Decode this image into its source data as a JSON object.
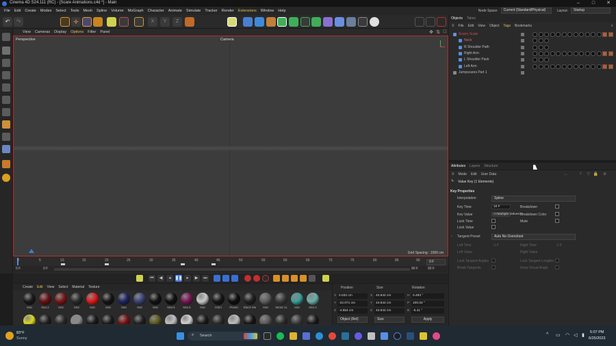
{
  "window": {
    "title": "Cinema 4D S24.111 (RC) - [Scare Animations.c4d *] - Main"
  },
  "menubar": {
    "items": [
      "File",
      "Edit",
      "Create",
      "Modes",
      "Select",
      "Tools",
      "Mesh",
      "Spline",
      "Volume",
      "MoGraph",
      "Character",
      "Animate",
      "Simulate",
      "Tracker",
      "Render",
      "Extensions",
      "Window",
      "Help"
    ],
    "node_space_label": "Node Space:",
    "node_space_value": "Current (Standard/Physical)",
    "layout_label": "Layout:",
    "layout_value": "Startup"
  },
  "viewport": {
    "menu": [
      "View",
      "Cameras",
      "Display",
      "Options",
      "Filter",
      "Panel"
    ],
    "label": "Perspective",
    "camera": "Camera",
    "grid_spacing": "Grid Spacing : 1000 cm"
  },
  "timeline": {
    "ticks": [
      "0",
      "5",
      "10",
      "15",
      "20",
      "25",
      "30",
      "35",
      "40",
      "45",
      "50",
      "55",
      "60",
      "65",
      "70",
      "75",
      "80",
      "85",
      "90"
    ],
    "current_frame": "0 F",
    "start_field": "0 F",
    "start_field2": "0 F",
    "end_field": "90 F",
    "end_field2": "90 F",
    "right_frame": "0 F"
  },
  "material_manager": {
    "menu": [
      "Create",
      "Edit",
      "View",
      "Select",
      "Material",
      "Texture"
    ],
    "materials": [
      {
        "name": "Mat",
        "color": "#1a1a1a"
      },
      {
        "name": "Mat.2",
        "color": "#6a1010"
      },
      {
        "name": "Mat",
        "color": "#7a1515"
      },
      {
        "name": "Mat",
        "color": "#2a2a2a"
      },
      {
        "name": "Mat",
        "color": "#e01818"
      },
      {
        "name": "Mat",
        "color": "#151515"
      },
      {
        "name": "Mat",
        "color": "#1c2460"
      },
      {
        "name": "Mat",
        "color": "#3a4275"
      },
      {
        "name": "Mat",
        "color": "#121212"
      },
      {
        "name": "Mat.5",
        "color": "#101010"
      },
      {
        "name": "Mat.6",
        "color": "#7a1555"
      },
      {
        "name": "Mat",
        "color": "#c8c8c8"
      },
      {
        "name": "tshirt",
        "color": "#161616"
      },
      {
        "name": "Plastic",
        "color": "#0e0e0e"
      },
      {
        "name": "Black Me",
        "color": "#202020"
      },
      {
        "name": "Mat",
        "color": "#5e5e5e"
      },
      {
        "name": "Metal 1s",
        "color": "#3a3a3a"
      },
      {
        "name": "Mat",
        "color": "#3a9e9a"
      },
      {
        "name": "Mat.3",
        "color": "#6ab0a8"
      }
    ],
    "row2_colors": [
      "#d8d820",
      "#202020",
      "#2a2a2a",
      "#8a8a8a",
      "#1a1a1a",
      "#1c1c1c",
      "#7a1010",
      "#1f1f1f",
      "#5a5a20",
      "#c0c0c0",
      "#d0d0d0",
      "#1a1a1a",
      "#2a2a2a",
      "#bdbdbd",
      "#151515",
      "#5a5a5a",
      "#2c2c2c",
      "#3a3a3a",
      "#1a1a1a"
    ]
  },
  "coordinates": {
    "headers": [
      "Position",
      "Size",
      "Rotation"
    ],
    "rows": [
      {
        "axis": "X",
        "pos": "0.032 cm",
        "size_axis": "X",
        "size": "43.842 cm",
        "rot_axis": "H",
        "rot": "0.493 °"
      },
      {
        "axis": "Y",
        "pos": "-22.071 cm",
        "size_axis": "Y",
        "size": "43.842 cm",
        "rot_axis": "P",
        "rot": "100.02 °"
      },
      {
        "axis": "Z",
        "pos": "-4.554 cm",
        "size_axis": "Z",
        "size": "43.842 cm",
        "rot_axis": "B",
        "rot": "-5.41 °"
      }
    ],
    "mode_left": "Object (Rel)",
    "mode_mid": "Size",
    "apply": "Apply"
  },
  "object_manager": {
    "tabs": [
      "Objects",
      "Takes"
    ],
    "menu": [
      "File",
      "Edit",
      "View",
      "Object",
      "Tags",
      "Bookmarks"
    ],
    "objects": [
      {
        "name": "Scarry Scale",
        "color": "#d34a4a",
        "indent": 0
      },
      {
        "name": "Neck",
        "color": "#d86a6a",
        "indent": 1
      },
      {
        "name": "R Shoulder Path",
        "color": "#bbbbbb",
        "indent": 1
      },
      {
        "name": "Right Arm",
        "color": "#bbbbbb",
        "indent": 1
      },
      {
        "name": "L Shoulder Pack",
        "color": "#bbbbbb",
        "indent": 1
      },
      {
        "name": "Left Arm",
        "color": "#bbbbbb",
        "indent": 1
      },
      {
        "name": "Jumpscares Part 1",
        "color": "#bbbbbb",
        "indent": 0
      }
    ]
  },
  "attributes": {
    "tabs": [
      "Attributes",
      "Layers",
      "Structure"
    ],
    "menu": [
      "Mode",
      "Edit",
      "User Data"
    ],
    "header": "Value Key (1 Elements)",
    "section": "Key Properties",
    "interpolation_label": "Interpolation",
    "interpolation_value": "Spline",
    "key_time_label": "Key Time",
    "key_time_value": "10 F",
    "key_value_label": "Key Value",
    "key_value_value": "<<Multiple Values>>",
    "lock_time_label": "Lock Time",
    "lock_value_label": "Lock Value",
    "breakdown_label": "Breakdown",
    "breakdown_color_label": "Breakdown Color",
    "mute_label": "Mute",
    "tangent_preset_label": "Tangent Preset",
    "tangent_preset_value": "Auto No Overshoot",
    "left_time_label": "Left Time",
    "left_time_value": "-1 F",
    "right_time_label": "Right Time",
    "right_time_value": "-1 F",
    "left_value_label": "Left Value",
    "right_value_label": "Right Value",
    "lock_tangent_angles_label": "Lock Tangent Angles",
    "lock_tangent_lengths_label": "Lock Tangent Lengths",
    "break_tangents_label": "Break Tangents",
    "keep_visual_angle_label": "Keep Visual Angle"
  },
  "taskbar": {
    "weather_temp": "83°F",
    "weather_desc": "Sunny",
    "search": "Search",
    "time": "5:07 PM",
    "date": "6/25/2023"
  }
}
